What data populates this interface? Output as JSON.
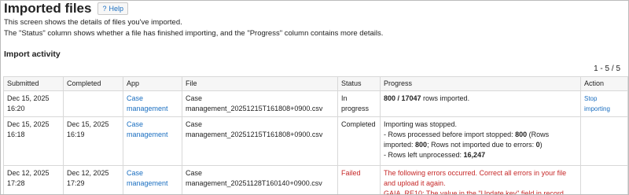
{
  "page": {
    "title": "Imported files",
    "help_label": "Help",
    "description_line1": "This screen shows the details of files you've imported.",
    "description_line2": "The \"Status\" column shows whether a file has finished importing, and the \"Progress\" column contains more details."
  },
  "import_activity": {
    "heading": "Import activity",
    "pager": "1 - 5 / 5",
    "columns": {
      "submitted": "Submitted",
      "completed": "Completed",
      "app": "App",
      "file": "File",
      "status": "Status",
      "progress": "Progress",
      "action": "Action"
    },
    "rows": [
      {
        "submitted_date": "Dec 15, 2025",
        "submitted_time": "16:20",
        "completed_date": "",
        "completed_time": "",
        "app_line1": "Case",
        "app_line2": "management",
        "file_line1": "Case",
        "file_line2": "management_20251215T161808+0900.csv",
        "status_line1": "In",
        "status_line2": "progress",
        "progress_count": "800 / 17047",
        "progress_suffix": " rows imported.",
        "action": "Stop importing"
      },
      {
        "submitted_date": "Dec 15, 2025",
        "submitted_time": "16:18",
        "completed_date": "Dec 15, 2025",
        "completed_time": "16:19",
        "app_line1": "Case",
        "app_line2": "management",
        "file_line1": "Case",
        "file_line2": "management_20251215T161808+0900.csv",
        "status": "Completed",
        "progress_stopped": "Importing was stopped.",
        "progress_processed_prefix": "- Rows processed before import stopped: ",
        "progress_processed_value": "800",
        "progress_processed_mid": " (Rows imported: ",
        "progress_imported_value": "800",
        "progress_errors_mid": "; Rows not imported due to errors: ",
        "progress_errors_value": "0",
        "progress_errors_end": ")",
        "progress_left_prefix": "- Rows left unprocessed: ",
        "progress_left_value": "16,247",
        "action": ""
      },
      {
        "submitted_date": "Dec 12, 2025",
        "submitted_time": "17:28",
        "completed_date": "Dec 12, 2025",
        "completed_time": "17:29",
        "app_line1": "Case",
        "app_line2": "management",
        "file_line1": "Case",
        "file_line2": "management_20251128T160140+0900.csv",
        "status": "Failed",
        "progress_error_line1": "The following errors occurred. Correct all errors in your file",
        "progress_error_line2": "and upload it again.",
        "progress_error_line3": "GAIA_RE10: The value in the \"Update key\" field in record",
        "action": ""
      }
    ]
  },
  "colors": {
    "link": "#1a6ec0",
    "error": "#c62828",
    "header_bg": "#f6f6f6",
    "border": "#d8d8d8"
  }
}
